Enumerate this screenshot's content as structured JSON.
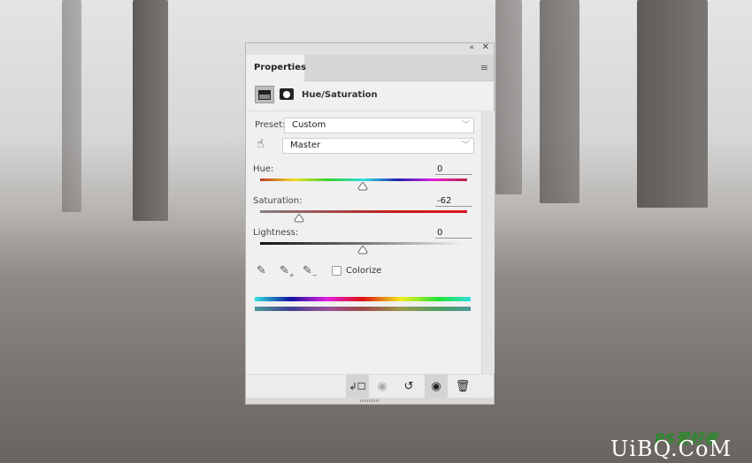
{
  "panel": {
    "title": "Properties",
    "collapse_icon": "double-chevron-left-icon",
    "close_icon": "close-icon",
    "menu_icon": "hamburger-menu-icon",
    "adjustment_title": "Hue/Saturation",
    "preset": {
      "label": "Preset:",
      "value": "Custom"
    },
    "channel": {
      "value": "Master"
    },
    "hue": {
      "label": "Hue:",
      "value": "0",
      "level": 0
    },
    "saturation": {
      "label": "Saturation:",
      "value": "-62",
      "level": -62
    },
    "lightness": {
      "label": "Lightness:",
      "value": "0",
      "level": 0
    },
    "colorize": {
      "label": "Colorize",
      "checked": false
    },
    "footer_icons": [
      "clip-to-layer-icon",
      "view-previous-state-icon",
      "reset-icon",
      "visibility-eye-icon",
      "trash-icon"
    ]
  },
  "watermark": {
    "text1": "PS爱好者",
    "text2": "UiBQ.CoM"
  }
}
